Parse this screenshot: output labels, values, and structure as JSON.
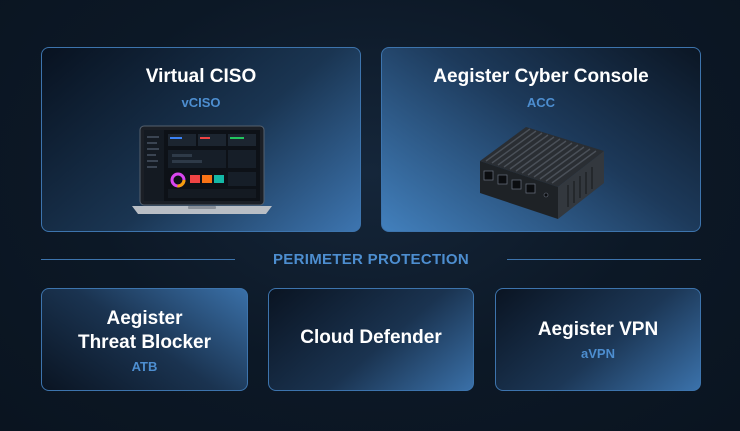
{
  "cards": {
    "vciso": {
      "title": "Virtual CISO",
      "subtitle": "vCISO"
    },
    "acc": {
      "title": "Aegister Cyber Console",
      "subtitle": "ACC"
    },
    "atb": {
      "title_line1": "Aegister",
      "title_line2": "Threat Blocker",
      "subtitle": "ATB"
    },
    "cloud": {
      "title": "Cloud Defender"
    },
    "vpn": {
      "title": "Aegister VPN",
      "subtitle": "aVPN"
    }
  },
  "section": {
    "title": "PERIMETER PROTECTION"
  },
  "colors": {
    "border": "#3d74ad",
    "accent": "#4d8ed0",
    "background": "#0c1826"
  },
  "icons": [
    "laptop-dashboard-icon",
    "mini-pc-appliance-icon"
  ]
}
